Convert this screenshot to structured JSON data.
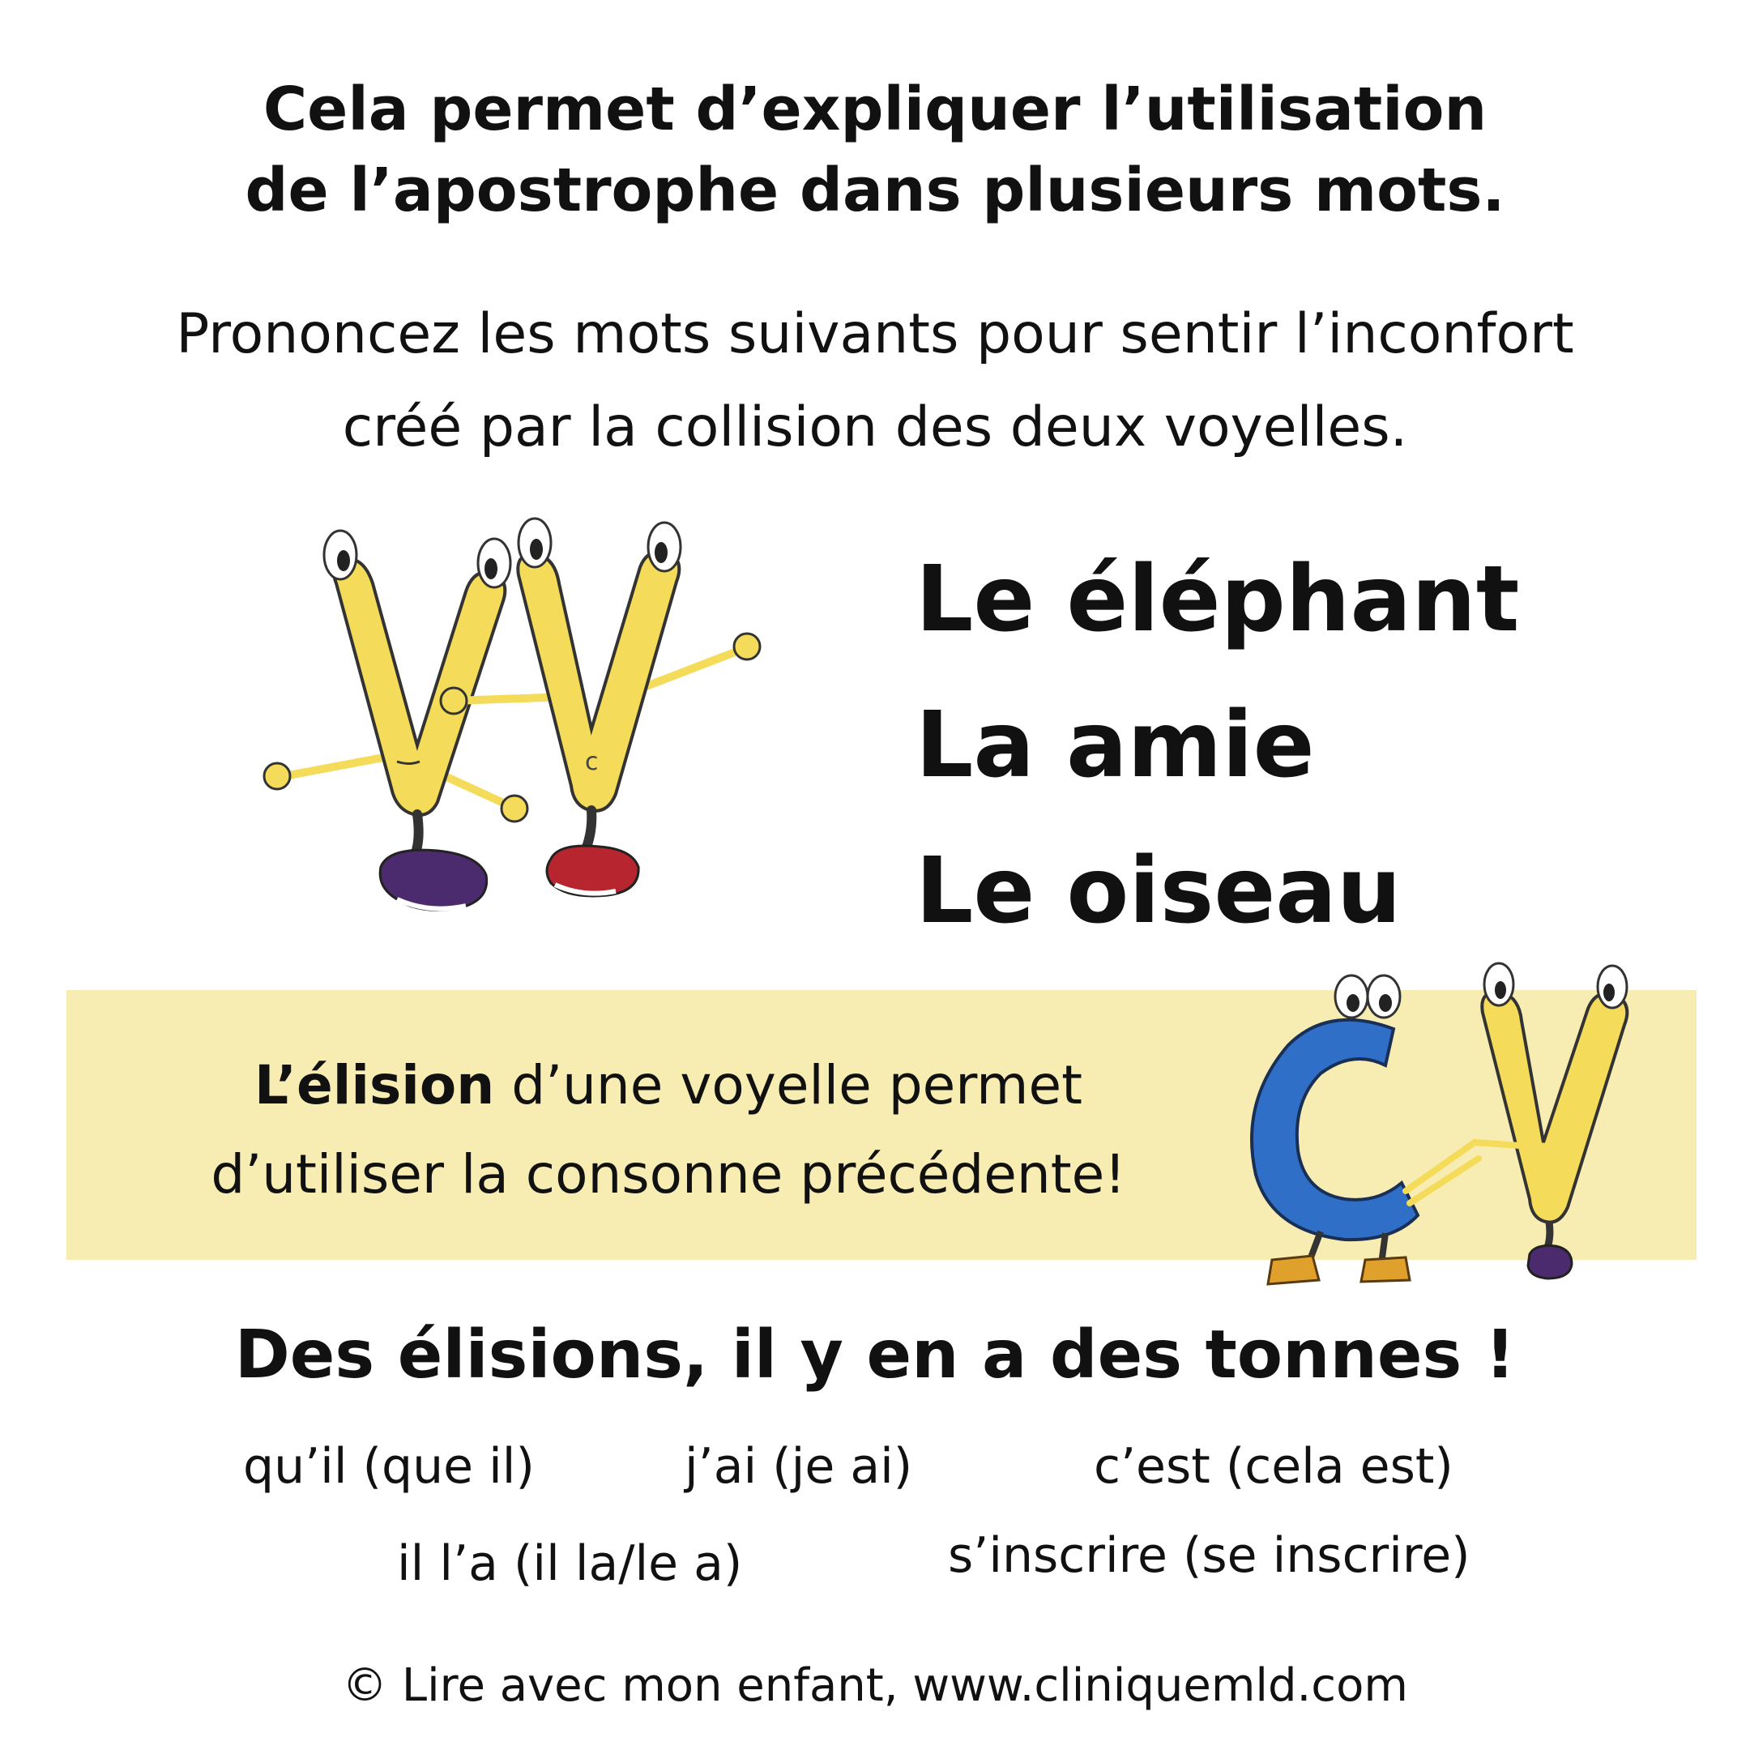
{
  "title": {
    "line1": "Cela permet d’expliquer l’utilisation",
    "line2": "de l’apostrophe dans plusieurs mots."
  },
  "subtitle": {
    "line1": "Prononcez les mots suivants pour sentir l’inconfort",
    "line2": "créé par la collision des deux voyelles."
  },
  "examples_collision": [
    "Le éléphant",
    "La amie",
    "Le oiseau"
  ],
  "vowel_letter_mark": "c",
  "elision_box": {
    "keyword": "L’élision",
    "rest_line1": " d’une voyelle permet",
    "line2": "d’utiliser la consonne précédente!",
    "background": "#f7edb3"
  },
  "list_heading": "Des élisions, il y en a des tonnes !",
  "elisions": [
    "qu’il (que il)",
    "j’ai (je ai)",
    "c’est (cela est)",
    "il l’a (il la/le a)",
    "s’inscrire (se inscrire)"
  ],
  "footer": "© Lire avec mon enfant, www.cliniquemld.com",
  "colors": {
    "vowel_yellow": "#f4dc5a",
    "consonant_blue": "#2f6fc8",
    "shoe_purple": "#4b2a6e",
    "shoe_red": "#b7252f",
    "boot_orange": "#e0a12c"
  }
}
